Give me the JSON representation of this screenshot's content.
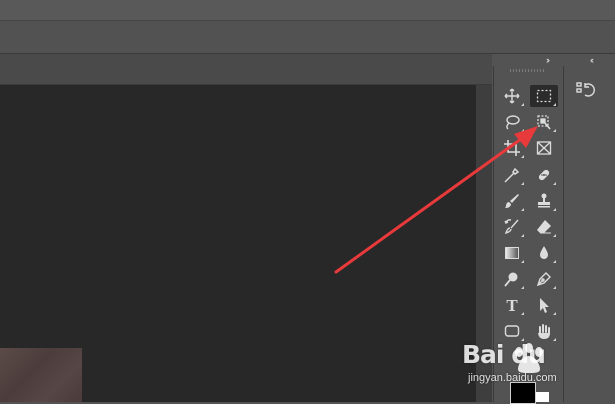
{
  "panel_toggles": {
    "left": "››",
    "right": "‹‹"
  },
  "toolbar": {
    "tools": [
      {
        "name": "move-tool-icon",
        "active": false,
        "flyout": true
      },
      {
        "name": "rectangular-marquee-tool-icon",
        "active": true,
        "flyout": true
      },
      {
        "name": "lasso-tool-icon",
        "active": false,
        "flyout": true
      },
      {
        "name": "object-selection-tool-icon",
        "active": false,
        "flyout": true
      },
      {
        "name": "crop-tool-icon",
        "active": false,
        "flyout": true
      },
      {
        "name": "frame-tool-icon",
        "active": false,
        "flyout": false
      },
      {
        "name": "eyedropper-tool-icon",
        "active": false,
        "flyout": true
      },
      {
        "name": "healing-brush-tool-icon",
        "active": false,
        "flyout": true
      },
      {
        "name": "brush-tool-icon",
        "active": false,
        "flyout": true
      },
      {
        "name": "clone-stamp-tool-icon",
        "active": false,
        "flyout": true
      },
      {
        "name": "history-brush-tool-icon",
        "active": false,
        "flyout": true
      },
      {
        "name": "eraser-tool-icon",
        "active": false,
        "flyout": true
      },
      {
        "name": "gradient-tool-icon",
        "active": false,
        "flyout": true
      },
      {
        "name": "blur-tool-icon",
        "active": false,
        "flyout": true
      },
      {
        "name": "dodge-tool-icon",
        "active": false,
        "flyout": true
      },
      {
        "name": "pen-tool-icon",
        "active": false,
        "flyout": true
      },
      {
        "name": "type-tool-icon",
        "active": false,
        "flyout": true
      },
      {
        "name": "path-selection-tool-icon",
        "active": false,
        "flyout": true
      },
      {
        "name": "rectangle-tool-icon",
        "active": false,
        "flyout": true
      },
      {
        "name": "hand-tool-icon",
        "active": false,
        "flyout": true
      }
    ],
    "type_glyph": "T",
    "foreground_color": "#000000",
    "background_color": "#ffffff"
  },
  "right_panel": {
    "icon": "history-panel-icon"
  },
  "annotation": {
    "color": "#e8393b",
    "points_to": "object-selection-tool-icon"
  },
  "watermark": {
    "logo": "Bai du",
    "url": "jingyan.baidu.com"
  }
}
